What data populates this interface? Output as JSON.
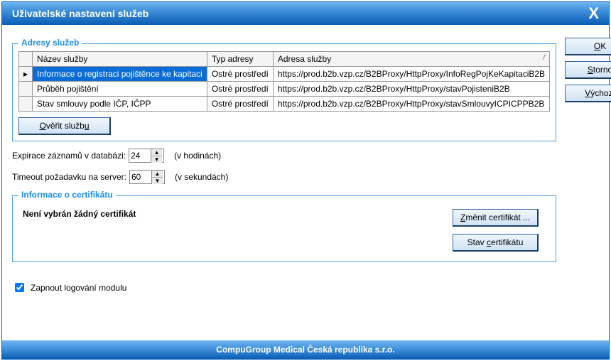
{
  "window": {
    "title": "Uživatelské nastavení služeb",
    "close_label": "X"
  },
  "buttons": {
    "ok": "OK",
    "storno": "Storno",
    "vychozi": "Výchozí",
    "overit": "Ověřit službu",
    "zmenit_cert": "Změnit certifikát ...",
    "stav_cert": "Stav certifikátu"
  },
  "groups": {
    "addresses_legend": "Adresy služeb",
    "cert_legend": "Informace o certifikátu"
  },
  "table": {
    "headers": {
      "name": "Název služby",
      "type": "Typ adresy",
      "addr": "Adresa služby"
    },
    "rows": [
      {
        "name": "Informace o registraci pojištěnce ke kapitaci",
        "type": "Ostré prostředí",
        "addr": "https://prod.b2b.vzp.cz/B2BProxy/HttpProxy/InfoRegPojKeKapitaciB2B"
      },
      {
        "name": "Průběh pojištění",
        "type": "Ostré prostředí",
        "addr": "https://prod.b2b.vzp.cz/B2BProxy/HttpProxy/stavPojisteniB2B"
      },
      {
        "name": "Stav smlouvy podle IČP, IČPP",
        "type": "Ostré prostředí",
        "addr": "https://prod.b2b.vzp.cz/B2BProxy/HttpProxy/stavSmlouvyICPICPPB2B"
      }
    ]
  },
  "form": {
    "expirace_label": "Expirace záznamů v databázi:",
    "expirace_value": "24",
    "expirace_unit": "(v hodinách)",
    "timeout_label": "Timeout požadavku na server:",
    "timeout_value": "60",
    "timeout_unit": "(v sekundách)"
  },
  "cert": {
    "none_text": "Není vybrán žádný certifikát"
  },
  "logging": {
    "label": "Zapnout logování modulu",
    "checked": true
  },
  "footer": "CompuGroup Medical Česká republika s.r.o."
}
